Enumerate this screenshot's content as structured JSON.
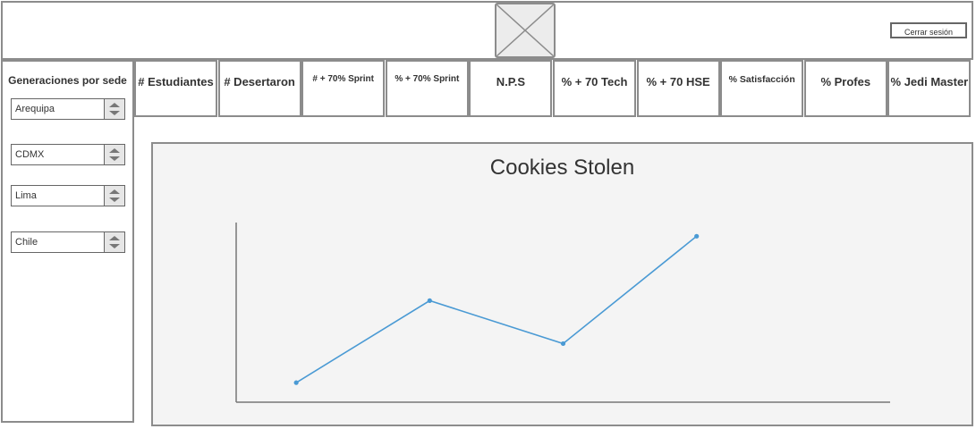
{
  "header": {
    "logout_label": "Cerrar sesión"
  },
  "sidebar": {
    "title": "Generaciones por sede",
    "selects": [
      {
        "value": "Arequipa"
      },
      {
        "value": "CDMX"
      },
      {
        "value": "Lima"
      },
      {
        "value": "Chile"
      }
    ]
  },
  "kpis": [
    {
      "label": "# Estudiantes"
    },
    {
      "label": "# Desertaron"
    },
    {
      "label": "# + 70% Sprint"
    },
    {
      "label": "% + 70% Sprint"
    },
    {
      "label": "N.P.S"
    },
    {
      "label": "% + 70 Tech"
    },
    {
      "label": "% + 70 HSE"
    },
    {
      "label": "% Satisfacción"
    },
    {
      "label": "% Profes"
    },
    {
      "label": "% Jedi Master"
    }
  ],
  "chart_data": {
    "type": "line",
    "title": "Cookies Stolen",
    "xlabel": "",
    "ylabel": "",
    "x": [
      1,
      2,
      3,
      4
    ],
    "series": [
      {
        "values": [
          10,
          52,
          30,
          85
        ],
        "color": "#4a9ad4"
      }
    ],
    "xlim": [
      0.55,
      5.45
    ],
    "ylim": [
      0,
      92
    ],
    "grid": false
  },
  "colors": {
    "border": "#8c8c8c",
    "panel_bg": "#f4f4f4",
    "line": "#4a9ad4"
  }
}
